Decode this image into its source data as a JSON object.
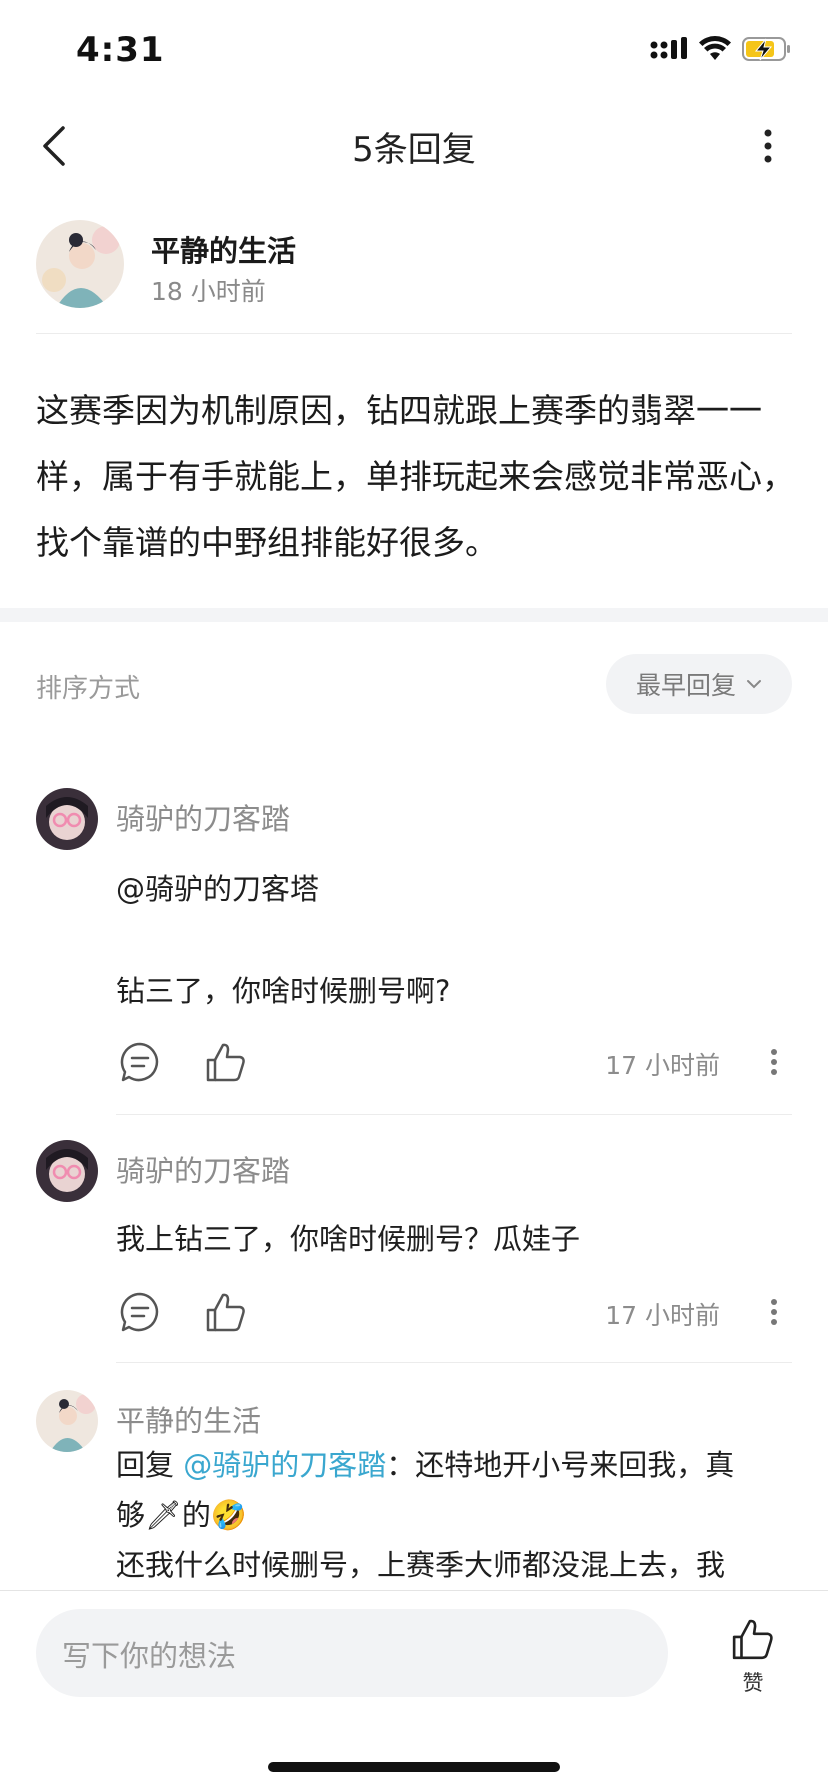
{
  "status": {
    "time": "4:31",
    "battery_color": "#f5c518"
  },
  "header": {
    "title": "5条回复",
    "back_icon": "chevron-left-icon",
    "more_icon": "more-vertical-icon"
  },
  "post": {
    "author": "平静的生活",
    "time": "18 小时前",
    "body": "这赛季因为机制原因，钻四就跟上赛季的翡翠一一样，属于有手就能上，单排玩起来会感觉非常恶心，找个靠谱的中野组排能好很多。"
  },
  "sort": {
    "label": "排序方式",
    "selected": "最早回复"
  },
  "comments": [
    {
      "author": "骑驴的刀客踏",
      "line1": "@骑驴的刀客塔",
      "line2": "钻三了，你啥时候删号啊?",
      "time": "17 小时前"
    },
    {
      "author": "骑驴的刀客踏",
      "line1": "我上钻三了，你啥时候删号？瓜娃子",
      "time": "17 小时前"
    },
    {
      "author": "平静的生活",
      "reply_prefix": "回复 ",
      "mention": "@骑驴的刀客踏",
      "reply_text": "：还特地开小号来回我，真",
      "line2_a": "够",
      "line2_emoji1": "🗡",
      "line2_b": "的",
      "line2_emoji2": "🤣",
      "line3": "还我什么时候删号，上赛季大师都没混上去，我"
    }
  ],
  "bottom": {
    "placeholder": "写下你的想法",
    "like_label": "赞"
  },
  "colors": {
    "accent": "#3aa7cf",
    "muted": "#8c8c8c"
  }
}
